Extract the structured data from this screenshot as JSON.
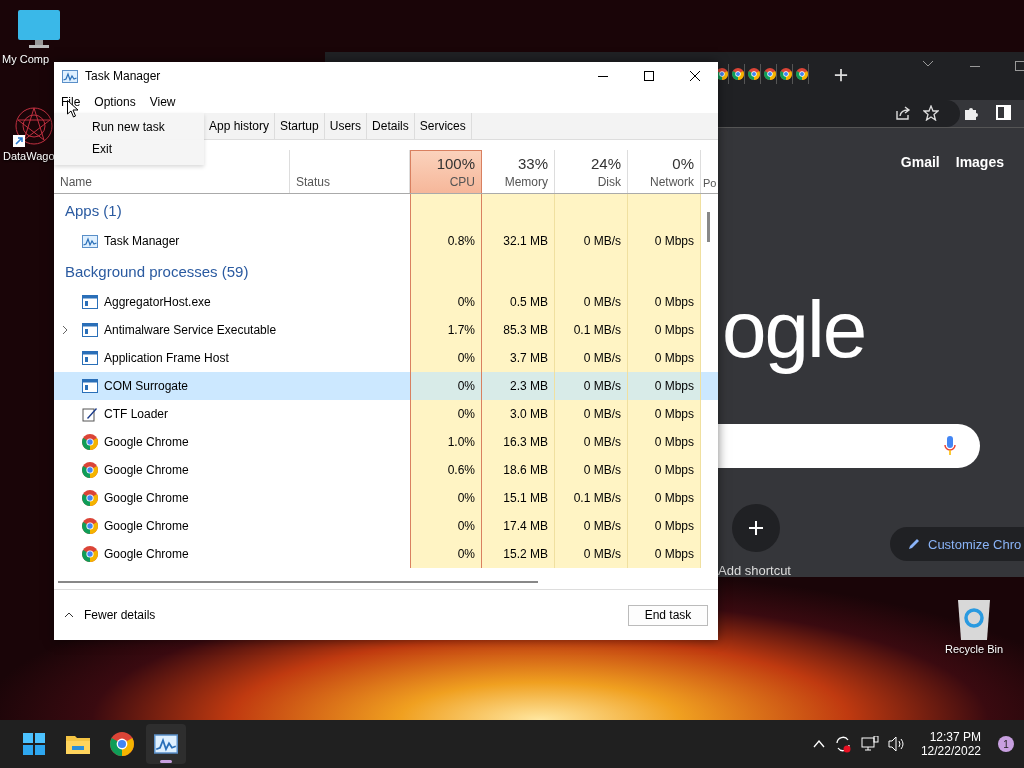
{
  "desktop_icons": [
    {
      "kind": "monitor",
      "label": "My Comp"
    },
    {
      "kind": "shortcut",
      "label": "DataWago"
    },
    {
      "kind": "bin",
      "label": "Recycle Bin"
    }
  ],
  "chrome": {
    "links": [
      "Gmail",
      "Images"
    ],
    "logo": "ogle",
    "shortcut_label": "Add shortcut",
    "customize": "Customize Chro"
  },
  "task_manager": {
    "title": "Task Manager",
    "menu": [
      "File",
      "Options",
      "View"
    ],
    "file_menu": [
      "Run new task",
      "Exit"
    ],
    "tabs": [
      "App history",
      "Startup",
      "Users",
      "Details",
      "Services"
    ],
    "columns": [
      {
        "label": "Name",
        "sorted": false
      },
      {
        "label": "Status",
        "sorted": false
      },
      {
        "percent": "100%",
        "label": "CPU",
        "sorted": true
      },
      {
        "percent": "33%",
        "label": "Memory",
        "sorted": false
      },
      {
        "percent": "24%",
        "label": "Disk",
        "sorted": false
      },
      {
        "percent": "0%",
        "label": "Network",
        "sorted": false
      },
      {
        "label": "Po",
        "sorted": false
      }
    ],
    "rows": [
      {
        "kind": "group",
        "label": "Apps (1)"
      },
      {
        "kind": "app",
        "name": "Task Manager",
        "expandable": false,
        "selected": false,
        "cpu": "0.8%",
        "memory": "32.1 MB",
        "disk": "0 MB/s",
        "network": "0 Mbps"
      },
      {
        "kind": "group",
        "label": "Background processes (59)"
      },
      {
        "kind": "process",
        "name": "AggregatorHost.exe",
        "expandable": false,
        "selected": false,
        "cpu": "0%",
        "memory": "0.5 MB",
        "disk": "0 MB/s",
        "network": "0 Mbps"
      },
      {
        "kind": "process",
        "name": "Antimalware Service Executable",
        "expandable": true,
        "selected": false,
        "cpu": "1.7%",
        "memory": "85.3 MB",
        "disk": "0.1 MB/s",
        "network": "0 Mbps"
      },
      {
        "kind": "process",
        "name": "Application Frame Host",
        "expandable": false,
        "selected": false,
        "cpu": "0%",
        "memory": "3.7 MB",
        "disk": "0 MB/s",
        "network": "0 Mbps"
      },
      {
        "kind": "process",
        "name": "COM Surrogate",
        "expandable": false,
        "selected": true,
        "cpu": "0%",
        "memory": "2.3 MB",
        "disk": "0 MB/s",
        "network": "0 Mbps"
      },
      {
        "kind": "tool",
        "name": "CTF Loader",
        "expandable": false,
        "selected": false,
        "cpu": "0%",
        "memory": "3.0 MB",
        "disk": "0 MB/s",
        "network": "0 Mbps"
      },
      {
        "kind": "browser",
        "name": "Google Chrome",
        "expandable": false,
        "selected": false,
        "cpu": "1.0%",
        "memory": "16.3 MB",
        "disk": "0 MB/s",
        "network": "0 Mbps"
      },
      {
        "kind": "browser",
        "name": "Google Chrome",
        "expandable": false,
        "selected": false,
        "cpu": "0.6%",
        "memory": "18.6 MB",
        "disk": "0 MB/s",
        "network": "0 Mbps"
      },
      {
        "kind": "browser",
        "name": "Google Chrome",
        "expandable": false,
        "selected": false,
        "cpu": "0%",
        "memory": "15.1 MB",
        "disk": "0.1 MB/s",
        "network": "0 Mbps"
      },
      {
        "kind": "browser",
        "name": "Google Chrome",
        "expandable": false,
        "selected": false,
        "cpu": "0%",
        "memory": "17.4 MB",
        "disk": "0 MB/s",
        "network": "0 Mbps"
      },
      {
        "kind": "browser",
        "name": "Google Chrome",
        "expandable": false,
        "selected": false,
        "cpu": "0%",
        "memory": "15.2 MB",
        "disk": "0 MB/s",
        "network": "0 Mbps"
      }
    ],
    "fewer_details": "Fewer details",
    "end_task": "End task"
  },
  "taskbar": {
    "apps": [
      {
        "kind": "start",
        "active": false
      },
      {
        "kind": "explorer",
        "active": false
      },
      {
        "kind": "chrome",
        "active": false
      },
      {
        "kind": "taskmgr",
        "active": true
      }
    ],
    "time": "12:37 PM",
    "date": "12/22/2022",
    "notifications": "1"
  }
}
